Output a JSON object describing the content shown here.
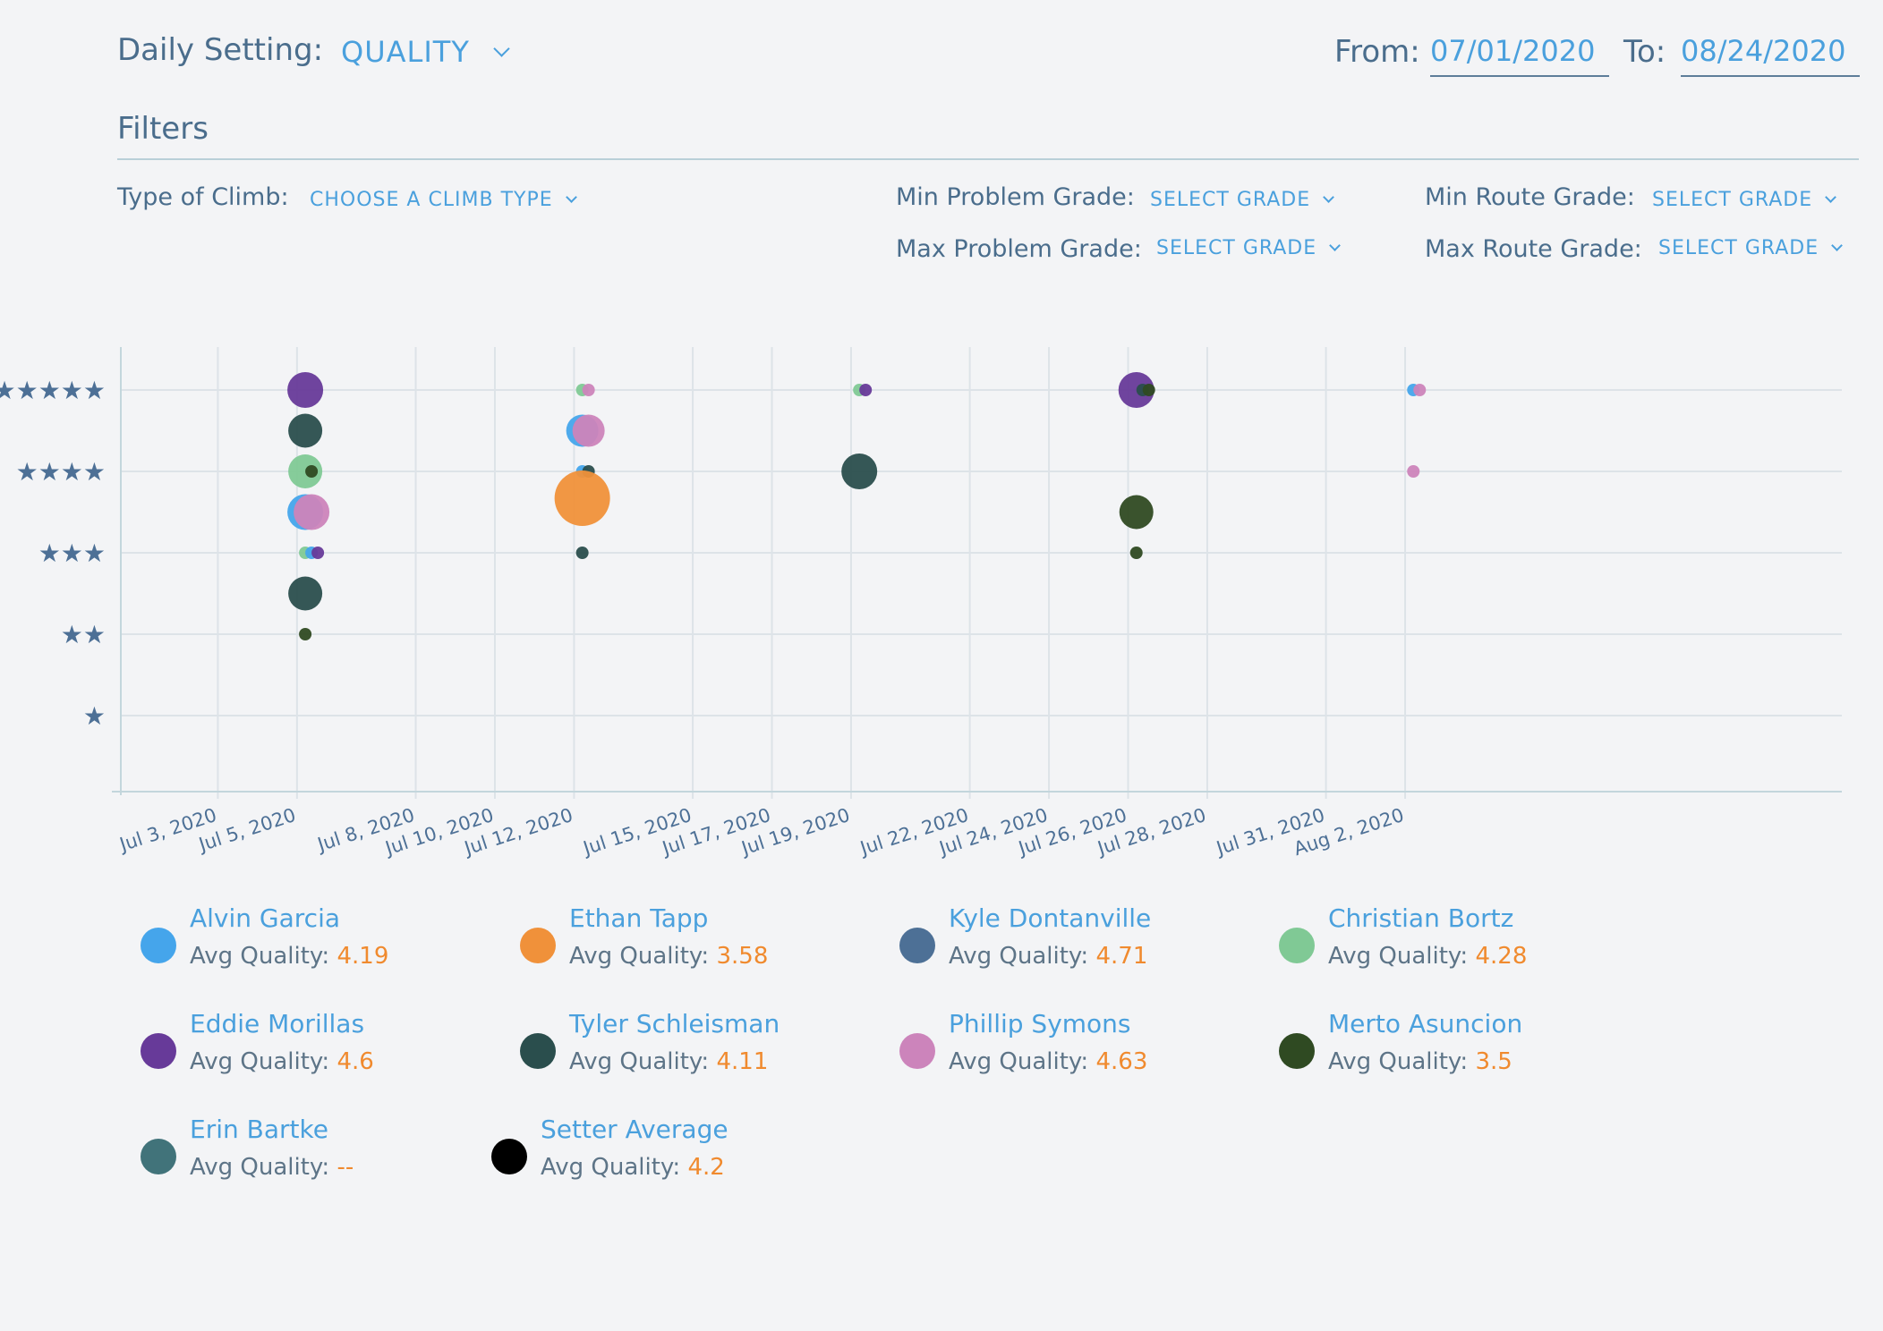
{
  "header": {
    "daily_setting_label": "Daily Setting:",
    "daily_setting_value": "QUALITY",
    "from_label": "From:",
    "from_value": "07/01/2020",
    "to_label": "To:",
    "to_value": "08/24/2020"
  },
  "filters": {
    "title": "Filters",
    "climb_type_label": "Type of Climb:",
    "climb_type_value": "CHOOSE A CLIMB TYPE",
    "min_problem_label": "Min Problem Grade:",
    "min_problem_value": "SELECT GRADE",
    "max_problem_label": "Max Problem Grade:",
    "max_problem_value": "SELECT GRADE",
    "min_route_label": "Min Route Grade:",
    "min_route_value": "SELECT GRADE",
    "max_route_label": "Max Route Grade:",
    "max_route_value": "SELECT GRADE"
  },
  "chart_data": {
    "type": "scatter",
    "x_tick_labels": [
      "Jul 3, 2020",
      "Jul 5, 2020",
      "Jul 8, 2020",
      "Jul 10, 2020",
      "Jul 12, 2020",
      "Jul 15, 2020",
      "Jul 17, 2020",
      "Jul 19, 2020",
      "Jul 22, 2020",
      "Jul 24, 2020",
      "Jul 26, 2020",
      "Jul 28, 2020",
      "Jul 31, 2020",
      "Aug 2, 2020"
    ],
    "y_tick_labels": [
      "★",
      "★★",
      "★★★",
      "★★★★",
      "★★★★★"
    ],
    "y_ticks": [
      1,
      2,
      3,
      4,
      5
    ],
    "ylim": [
      0,
      5.5
    ],
    "grid": true,
    "legend_position": "bottom",
    "points": [
      {
        "setter": "Eddie Morillas",
        "date": "Jul 6, 2020",
        "y": 5.0,
        "size": 20
      },
      {
        "setter": "Tyler Schleisman",
        "date": "Jul 6, 2020",
        "y": 4.5,
        "size": 19
      },
      {
        "setter": "Christian Bortz",
        "date": "Jul 6, 2020",
        "y": 4.0,
        "size": 19
      },
      {
        "setter": "Merto Asuncion",
        "date": "Jul 6, 2020",
        "y": 4.0,
        "size": 7
      },
      {
        "setter": "Alvin Garcia",
        "date": "Jul 6, 2020",
        "y": 3.5,
        "size": 20
      },
      {
        "setter": "Phillip Symons",
        "date": "Jul 6, 2020",
        "y": 3.5,
        "size": 20
      },
      {
        "setter": "Christian Bortz",
        "date": "Jul 6, 2020",
        "y": 3.0,
        "size": 7
      },
      {
        "setter": "Alvin Garcia",
        "date": "Jul 6, 2020",
        "y": 3.0,
        "size": 7
      },
      {
        "setter": "Eddie Morillas",
        "date": "Jul 6, 2020",
        "y": 3.0,
        "size": 7
      },
      {
        "setter": "Tyler Schleisman",
        "date": "Jul 6, 2020",
        "y": 2.5,
        "size": 19
      },
      {
        "setter": "Merto Asuncion",
        "date": "Jul 6, 2020",
        "y": 2.0,
        "size": 7
      },
      {
        "setter": "Christian Bortz",
        "date": "Jul 13, 2020",
        "y": 5.0,
        "size": 7
      },
      {
        "setter": "Phillip Symons",
        "date": "Jul 13, 2020",
        "y": 5.0,
        "size": 7
      },
      {
        "setter": "Alvin Garcia",
        "date": "Jul 13, 2020",
        "y": 4.5,
        "size": 18
      },
      {
        "setter": "Phillip Symons",
        "date": "Jul 13, 2020",
        "y": 4.5,
        "size": 18
      },
      {
        "setter": "Alvin Garcia",
        "date": "Jul 13, 2020",
        "y": 4.0,
        "size": 7
      },
      {
        "setter": "Tyler Schleisman",
        "date": "Jul 13, 2020",
        "y": 4.0,
        "size": 7
      },
      {
        "setter": "Ethan Tapp",
        "date": "Jul 13, 2020",
        "y": 3.67,
        "size": 31
      },
      {
        "setter": "Tyler Schleisman",
        "date": "Jul 13, 2020",
        "y": 3.0,
        "size": 7
      },
      {
        "setter": "Christian Bortz",
        "date": "Jul 20, 2020",
        "y": 5.0,
        "size": 7
      },
      {
        "setter": "Eddie Morillas",
        "date": "Jul 20, 2020",
        "y": 5.0,
        "size": 7
      },
      {
        "setter": "Tyler Schleisman",
        "date": "Jul 20, 2020",
        "y": 4.0,
        "size": 20
      },
      {
        "setter": "Eddie Morillas",
        "date": "Jul 27, 2020",
        "y": 5.0,
        "size": 20
      },
      {
        "setter": "Tyler Schleisman",
        "date": "Jul 27, 2020",
        "y": 5.0,
        "size": 7
      },
      {
        "setter": "Merto Asuncion",
        "date": "Jul 27, 2020",
        "y": 5.0,
        "size": 7
      },
      {
        "setter": "Merto Asuncion",
        "date": "Jul 27, 2020",
        "y": 3.5,
        "size": 19
      },
      {
        "setter": "Merto Asuncion",
        "date": "Jul 27, 2020",
        "y": 3.0,
        "size": 7
      },
      {
        "setter": "Alvin Garcia",
        "date": "Aug 3, 2020",
        "y": 5.0,
        "size": 7
      },
      {
        "setter": "Phillip Symons",
        "date": "Aug 3, 2020",
        "y": 5.0,
        "size": 7
      },
      {
        "setter": "Phillip Symons",
        "date": "Aug 3, 2020",
        "y": 4.0,
        "size": 7
      }
    ]
  },
  "legend": [
    {
      "name": "Alvin Garcia",
      "avg_label": "Avg Quality:",
      "avg": "4.19",
      "color": "#45a5eb"
    },
    {
      "name": "Ethan Tapp",
      "avg_label": "Avg Quality:",
      "avg": "3.58",
      "color": "#f0913a"
    },
    {
      "name": "Kyle Dontanville",
      "avg_label": "Avg Quality:",
      "avg": "4.71",
      "color": "#4d7096"
    },
    {
      "name": "Christian Bortz",
      "avg_label": "Avg Quality:",
      "avg": "4.28",
      "color": "#80c995"
    },
    {
      "name": "Eddie Morillas",
      "avg_label": "Avg Quality:",
      "avg": "4.6",
      "color": "#673a99"
    },
    {
      "name": "Tyler Schleisman",
      "avg_label": "Avg Quality:",
      "avg": "4.11",
      "color": "#2a4e4d"
    },
    {
      "name": "Phillip Symons",
      "avg_label": "Avg Quality:",
      "avg": "4.63",
      "color": "#cc84bb"
    },
    {
      "name": "Merto Asuncion",
      "avg_label": "Avg Quality:",
      "avg": "3.5",
      "color": "#2f4a22"
    },
    {
      "name": "Erin Bartke",
      "avg_label": "Avg Quality:",
      "avg": "--",
      "color": "#41737a"
    },
    {
      "name": "Setter Average",
      "avg_label": "Avg Quality:",
      "avg": "4.2",
      "color": "#000000"
    }
  ]
}
